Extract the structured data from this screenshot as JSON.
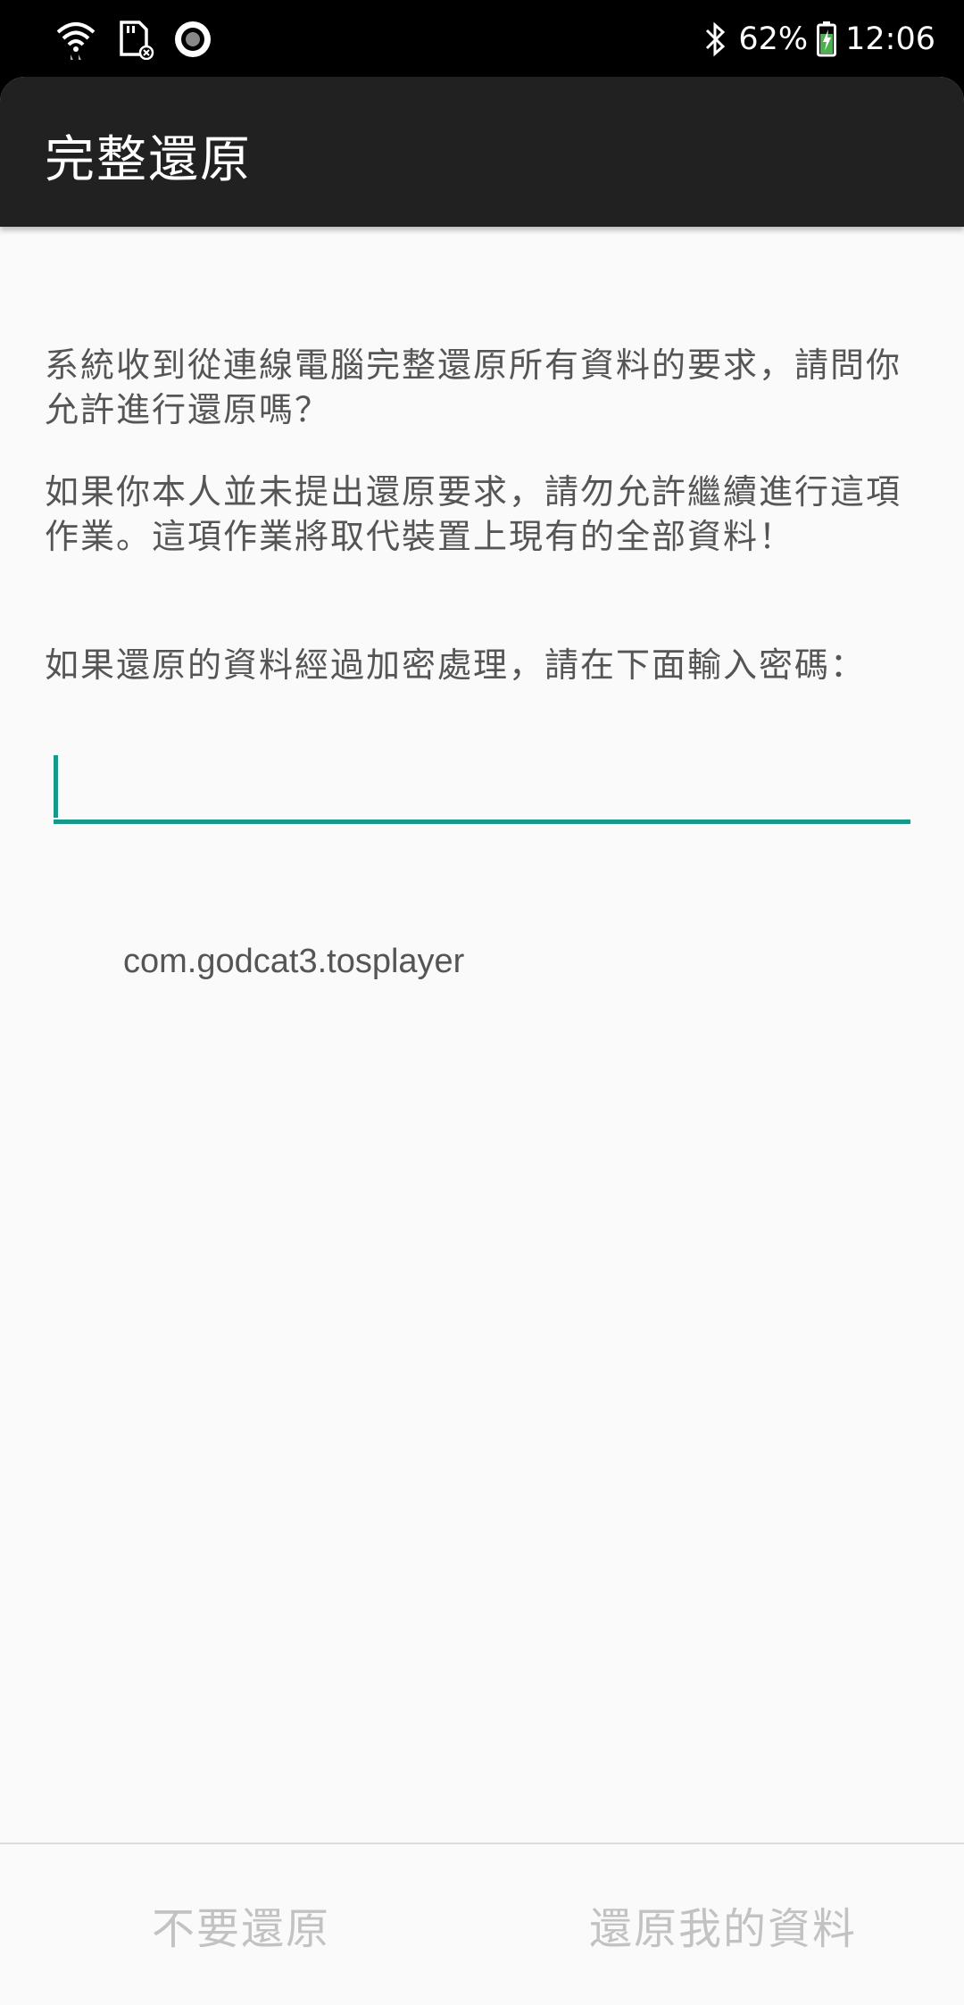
{
  "status_bar": {
    "battery_percent": "62%",
    "time": "12:06",
    "icons": [
      "wifi-icon",
      "sd-card-icon",
      "record-icon",
      "bluetooth-icon",
      "battery-charging-icon"
    ]
  },
  "toolbar": {
    "title": "完整還原"
  },
  "content": {
    "message_1": "系統收到從連線電腦完整還原所有資料的要求，請問你允許進行還原嗎？",
    "message_2": "如果你本人並未提出還原要求，請勿允許繼續進行這項作業。這項作業將取代裝置上現有的全部資料！",
    "password_prompt": "如果還原的資料經過加密處理，請在下面輸入密碼：",
    "password_value": "",
    "package_name": "com.godcat3.tosplayer"
  },
  "buttons": {
    "deny_label": "不要還原",
    "allow_label": "還原我的資料"
  },
  "colors": {
    "accent": "#14998a",
    "toolbar_bg": "#212121",
    "body_text": "#555555",
    "disabled_button": "#c2c2c2"
  }
}
